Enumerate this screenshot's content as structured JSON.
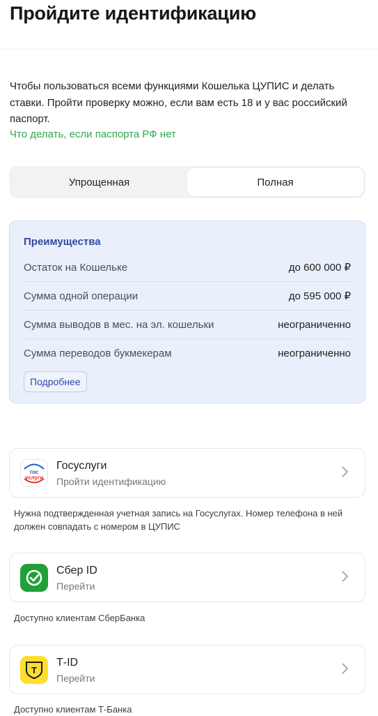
{
  "header": {
    "title": "Пройдите идентификацию"
  },
  "intro": {
    "text": "Чтобы пользоваться всеми функциями Кошелька ЦУПИС и делать ставки. Пройти проверку можно, если вам есть 18 и у вас российский паспорт.",
    "link": "Что делать, если паспорта РФ нет"
  },
  "segment": {
    "tabs": [
      "Упрощенная",
      "Полная"
    ],
    "selected": "Полная"
  },
  "benefits": {
    "title": "Преимущества",
    "rows": [
      {
        "label": "Остаток на Кошельке",
        "value": "до 600 000 ₽"
      },
      {
        "label": "Сумма одной операции",
        "value": "до 595 000 ₽"
      },
      {
        "label": "Сумма выводов в мес. на эл. кошельки",
        "value": "неограниченно"
      },
      {
        "label": "Сумма переводов букмекерам",
        "value": "неограниченно"
      }
    ],
    "more_label": "Подробнее"
  },
  "methods": [
    {
      "title": "Госуслуги",
      "subtitle": "Пройти идентификацию",
      "icon": "gosuslugi-logo",
      "logo_text": [
        "гос",
        "услуги"
      ],
      "note": "Нужна подтвержденная учетная запись на Госуслугах. Номер телефона в ней должен совпадать с номером в ЦУПИС"
    },
    {
      "title": "Сбер ID",
      "subtitle": "Перейти",
      "icon": "sber-logo",
      "note": "Доступно клиентам СберБанка"
    },
    {
      "title": "Т-ID",
      "subtitle": "Перейти",
      "icon": "tbank-logo",
      "logo_text": [
        "Т"
      ],
      "note": "Доступно клиентам Т-Банка"
    }
  ],
  "colors": {
    "accent_green": "#2fa84a",
    "benefits_bg": "#e9f0fb",
    "benefits_title": "#2f49a3",
    "sber_green": "#21a038",
    "tbank_yellow": "#ffdd2d"
  }
}
